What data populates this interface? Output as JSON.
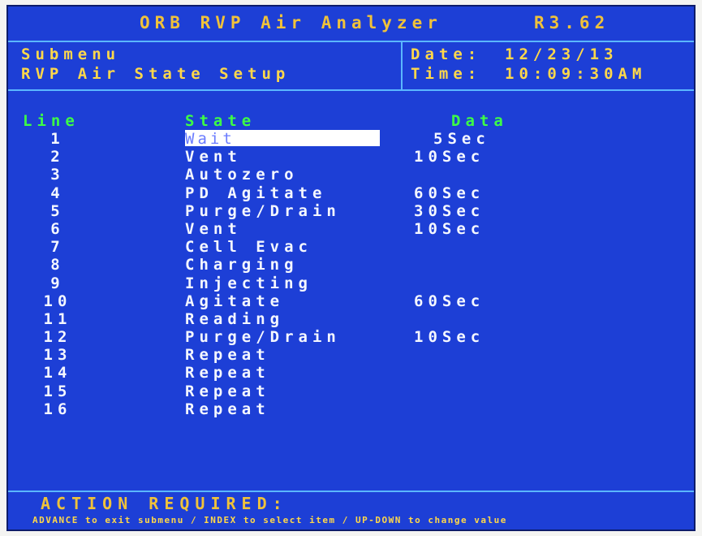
{
  "title": "ORB RVP Air Analyzer",
  "version": "R3.62",
  "header": {
    "submenu_label": "Submenu",
    "submenu_name": "RVP Air State Setup",
    "date_label": "Date:",
    "date_value": "12/23/13",
    "time_label": "Time:",
    "time_value": "10:09:30AM"
  },
  "columns": {
    "line": "Line",
    "state": "State",
    "data": "Data"
  },
  "rows": [
    {
      "line": "1",
      "state": "Wait",
      "data": "5Sec"
    },
    {
      "line": "2",
      "state": "Vent",
      "data": "10Sec"
    },
    {
      "line": "3",
      "state": "Autozero",
      "data": ""
    },
    {
      "line": "4",
      "state": "PD Agitate",
      "data": "60Sec"
    },
    {
      "line": "5",
      "state": "Purge/Drain",
      "data": "30Sec"
    },
    {
      "line": "6",
      "state": "Vent",
      "data": "10Sec"
    },
    {
      "line": "7",
      "state": "Cell Evac",
      "data": ""
    },
    {
      "line": "8",
      "state": "Charging",
      "data": ""
    },
    {
      "line": "9",
      "state": "Injecting",
      "data": ""
    },
    {
      "line": "10",
      "state": "Agitate",
      "data": "60Sec"
    },
    {
      "line": "11",
      "state": "Reading",
      "data": ""
    },
    {
      "line": "12",
      "state": "Purge/Drain",
      "data": "10Sec"
    },
    {
      "line": "13",
      "state": "Repeat",
      "data": ""
    },
    {
      "line": "14",
      "state": "Repeat",
      "data": ""
    },
    {
      "line": "15",
      "state": "Repeat",
      "data": ""
    },
    {
      "line": "16",
      "state": "Repeat",
      "data": ""
    }
  ],
  "footer": {
    "action": "ACTION REQUIRED:",
    "hint": "ADVANCE to exit submenu / INDEX to select item / UP-DOWN to change value"
  }
}
